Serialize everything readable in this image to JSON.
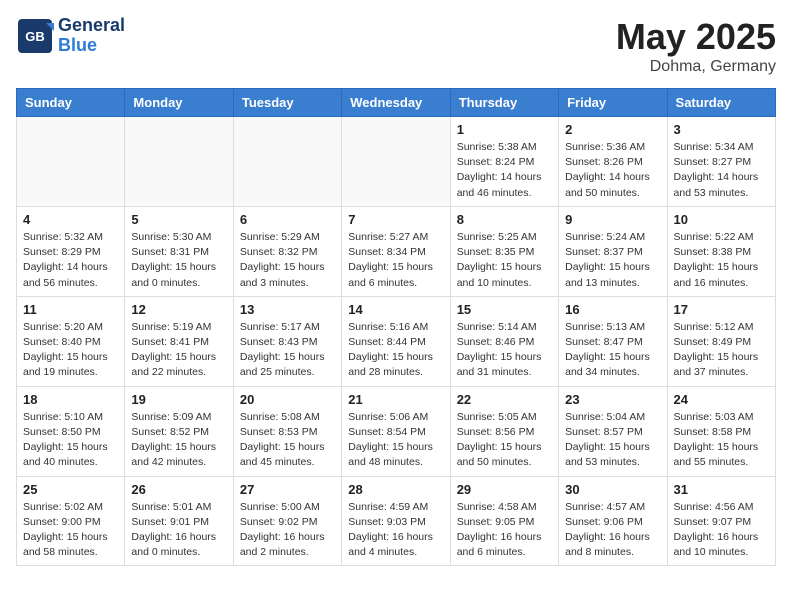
{
  "header": {
    "logo_line1": "General",
    "logo_line2": "Blue",
    "month": "May 2025",
    "location": "Dohma, Germany"
  },
  "days_of_week": [
    "Sunday",
    "Monday",
    "Tuesday",
    "Wednesday",
    "Thursday",
    "Friday",
    "Saturday"
  ],
  "weeks": [
    [
      {
        "num": "",
        "info": ""
      },
      {
        "num": "",
        "info": ""
      },
      {
        "num": "",
        "info": ""
      },
      {
        "num": "",
        "info": ""
      },
      {
        "num": "1",
        "info": "Sunrise: 5:38 AM\nSunset: 8:24 PM\nDaylight: 14 hours\nand 46 minutes."
      },
      {
        "num": "2",
        "info": "Sunrise: 5:36 AM\nSunset: 8:26 PM\nDaylight: 14 hours\nand 50 minutes."
      },
      {
        "num": "3",
        "info": "Sunrise: 5:34 AM\nSunset: 8:27 PM\nDaylight: 14 hours\nand 53 minutes."
      }
    ],
    [
      {
        "num": "4",
        "info": "Sunrise: 5:32 AM\nSunset: 8:29 PM\nDaylight: 14 hours\nand 56 minutes."
      },
      {
        "num": "5",
        "info": "Sunrise: 5:30 AM\nSunset: 8:31 PM\nDaylight: 15 hours\nand 0 minutes."
      },
      {
        "num": "6",
        "info": "Sunrise: 5:29 AM\nSunset: 8:32 PM\nDaylight: 15 hours\nand 3 minutes."
      },
      {
        "num": "7",
        "info": "Sunrise: 5:27 AM\nSunset: 8:34 PM\nDaylight: 15 hours\nand 6 minutes."
      },
      {
        "num": "8",
        "info": "Sunrise: 5:25 AM\nSunset: 8:35 PM\nDaylight: 15 hours\nand 10 minutes."
      },
      {
        "num": "9",
        "info": "Sunrise: 5:24 AM\nSunset: 8:37 PM\nDaylight: 15 hours\nand 13 minutes."
      },
      {
        "num": "10",
        "info": "Sunrise: 5:22 AM\nSunset: 8:38 PM\nDaylight: 15 hours\nand 16 minutes."
      }
    ],
    [
      {
        "num": "11",
        "info": "Sunrise: 5:20 AM\nSunset: 8:40 PM\nDaylight: 15 hours\nand 19 minutes."
      },
      {
        "num": "12",
        "info": "Sunrise: 5:19 AM\nSunset: 8:41 PM\nDaylight: 15 hours\nand 22 minutes."
      },
      {
        "num": "13",
        "info": "Sunrise: 5:17 AM\nSunset: 8:43 PM\nDaylight: 15 hours\nand 25 minutes."
      },
      {
        "num": "14",
        "info": "Sunrise: 5:16 AM\nSunset: 8:44 PM\nDaylight: 15 hours\nand 28 minutes."
      },
      {
        "num": "15",
        "info": "Sunrise: 5:14 AM\nSunset: 8:46 PM\nDaylight: 15 hours\nand 31 minutes."
      },
      {
        "num": "16",
        "info": "Sunrise: 5:13 AM\nSunset: 8:47 PM\nDaylight: 15 hours\nand 34 minutes."
      },
      {
        "num": "17",
        "info": "Sunrise: 5:12 AM\nSunset: 8:49 PM\nDaylight: 15 hours\nand 37 minutes."
      }
    ],
    [
      {
        "num": "18",
        "info": "Sunrise: 5:10 AM\nSunset: 8:50 PM\nDaylight: 15 hours\nand 40 minutes."
      },
      {
        "num": "19",
        "info": "Sunrise: 5:09 AM\nSunset: 8:52 PM\nDaylight: 15 hours\nand 42 minutes."
      },
      {
        "num": "20",
        "info": "Sunrise: 5:08 AM\nSunset: 8:53 PM\nDaylight: 15 hours\nand 45 minutes."
      },
      {
        "num": "21",
        "info": "Sunrise: 5:06 AM\nSunset: 8:54 PM\nDaylight: 15 hours\nand 48 minutes."
      },
      {
        "num": "22",
        "info": "Sunrise: 5:05 AM\nSunset: 8:56 PM\nDaylight: 15 hours\nand 50 minutes."
      },
      {
        "num": "23",
        "info": "Sunrise: 5:04 AM\nSunset: 8:57 PM\nDaylight: 15 hours\nand 53 minutes."
      },
      {
        "num": "24",
        "info": "Sunrise: 5:03 AM\nSunset: 8:58 PM\nDaylight: 15 hours\nand 55 minutes."
      }
    ],
    [
      {
        "num": "25",
        "info": "Sunrise: 5:02 AM\nSunset: 9:00 PM\nDaylight: 15 hours\nand 58 minutes."
      },
      {
        "num": "26",
        "info": "Sunrise: 5:01 AM\nSunset: 9:01 PM\nDaylight: 16 hours\nand 0 minutes."
      },
      {
        "num": "27",
        "info": "Sunrise: 5:00 AM\nSunset: 9:02 PM\nDaylight: 16 hours\nand 2 minutes."
      },
      {
        "num": "28",
        "info": "Sunrise: 4:59 AM\nSunset: 9:03 PM\nDaylight: 16 hours\nand 4 minutes."
      },
      {
        "num": "29",
        "info": "Sunrise: 4:58 AM\nSunset: 9:05 PM\nDaylight: 16 hours\nand 6 minutes."
      },
      {
        "num": "30",
        "info": "Sunrise: 4:57 AM\nSunset: 9:06 PM\nDaylight: 16 hours\nand 8 minutes."
      },
      {
        "num": "31",
        "info": "Sunrise: 4:56 AM\nSunset: 9:07 PM\nDaylight: 16 hours\nand 10 minutes."
      }
    ]
  ]
}
